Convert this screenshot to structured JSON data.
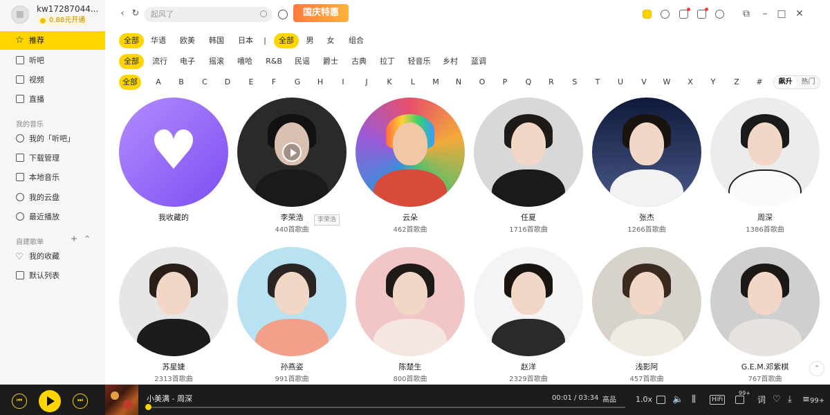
{
  "user": {
    "name": "kw17287044...",
    "vip_label": "0.88元开通"
  },
  "sidebar": {
    "items": [
      {
        "label": "推荐"
      },
      {
        "label": "听吧"
      },
      {
        "label": "视频"
      },
      {
        "label": "直播"
      }
    ],
    "my_music_title": "我的音乐",
    "my_music": [
      {
        "label": "我的「听吧」"
      },
      {
        "label": "下载管理"
      },
      {
        "label": "本地音乐"
      },
      {
        "label": "我的云盘"
      },
      {
        "label": "最近播放"
      }
    ],
    "playlists_title": "自建歌单",
    "playlist_tools": {
      "add": "+",
      "collapse": "^"
    },
    "playlists": [
      {
        "label": "我的收藏"
      },
      {
        "label": "默认列表"
      }
    ]
  },
  "topbar": {
    "search_placeholder": "起风了",
    "promo_label": "国庆特惠"
  },
  "filters": {
    "region": [
      "全部",
      "华语",
      "欧美",
      "韩国",
      "日本"
    ],
    "separator": "|",
    "gender": [
      "全部",
      "男",
      "女",
      "组合"
    ],
    "genre": [
      "全部",
      "流行",
      "电子",
      "摇滚",
      "嘻哈",
      "R&B",
      "民谣",
      "爵士",
      "古典",
      "拉丁",
      "轻音乐",
      "乡村",
      "蓝调"
    ],
    "letters": [
      "全部",
      "A",
      "B",
      "C",
      "D",
      "E",
      "F",
      "G",
      "H",
      "I",
      "J",
      "K",
      "L",
      "M",
      "N",
      "O",
      "P",
      "Q",
      "R",
      "S",
      "T",
      "U",
      "V",
      "W",
      "X",
      "Y",
      "Z",
      "#"
    ],
    "sort": [
      "飙升",
      "热门"
    ]
  },
  "artists": [
    {
      "name": "我收藏的",
      "count": ""
    },
    {
      "name": "李荣浩",
      "count": "440首歌曲"
    },
    {
      "name": "云朵",
      "count": "462首歌曲"
    },
    {
      "name": "任夏",
      "count": "1716首歌曲"
    },
    {
      "name": "张杰",
      "count": "1266首歌曲"
    },
    {
      "name": "周深",
      "count": "1386首歌曲"
    },
    {
      "name": "苏星婕",
      "count": "2313首歌曲"
    },
    {
      "name": "孙燕姿",
      "count": "991首歌曲"
    },
    {
      "name": "陈楚生",
      "count": "800首歌曲"
    },
    {
      "name": "赵洋",
      "count": "2329首歌曲"
    },
    {
      "name": "浅影阿",
      "count": "457首歌曲"
    },
    {
      "name": "G.E.M.邓紫棋",
      "count": "767首歌曲"
    }
  ],
  "tooltip": "李荣浩",
  "player": {
    "song": "小美满 - 周深",
    "time": "00:01 / 03:34",
    "progress": 0.005,
    "quality": "高品",
    "speed": "1.0x",
    "hifi": "HiFi",
    "comments": "99+",
    "lyrics": "词",
    "listeners": "99+"
  },
  "colors": {
    "accent": "#ffd500",
    "player_bg": "#1c1c1c",
    "sidebar_bg": "#f6f6f6"
  }
}
